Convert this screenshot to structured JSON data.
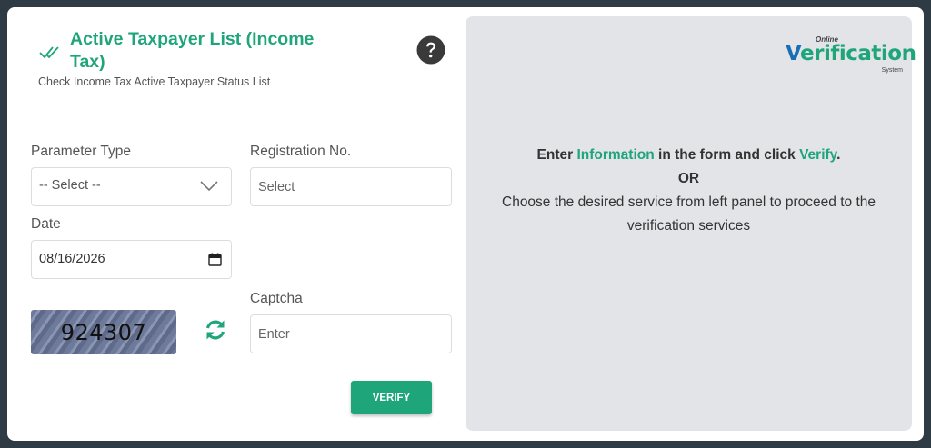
{
  "header": {
    "title": "Active Taxpayer List (Income Tax)",
    "subtitle": "Check Income Tax Active Taxpayer Status List"
  },
  "form": {
    "parameter_type_label": "Parameter Type",
    "parameter_type_value": "-- Select --",
    "registration_label": "Registration No.",
    "registration_placeholder": "Select",
    "date_label": "Date",
    "date_value": "08/16/2026",
    "captcha_label": "Captcha",
    "captcha_placeholder": "Enter",
    "captcha_code": "924307",
    "verify_label": "VERIFY"
  },
  "panel": {
    "logo_top": "Online",
    "logo_v": "V",
    "logo_rest": "erification",
    "logo_bottom": "System",
    "line1_pre": "Enter ",
    "line1_hl1": "Information",
    "line1_mid": " in the form and click ",
    "line1_hl2": "Verify",
    "line1_post": ".",
    "or": "OR",
    "line3": "Choose the desired service from left panel to proceed to the",
    "line4": "verification services"
  },
  "colors": {
    "accent": "#1ea57a",
    "logo_blue": "#1a6fb4",
    "background": "#2e3a44",
    "panel": "#e3e4e7"
  },
  "icons": [
    "double-check-icon",
    "help-icon",
    "chevron-down-icon",
    "calendar-icon",
    "refresh-icon"
  ]
}
